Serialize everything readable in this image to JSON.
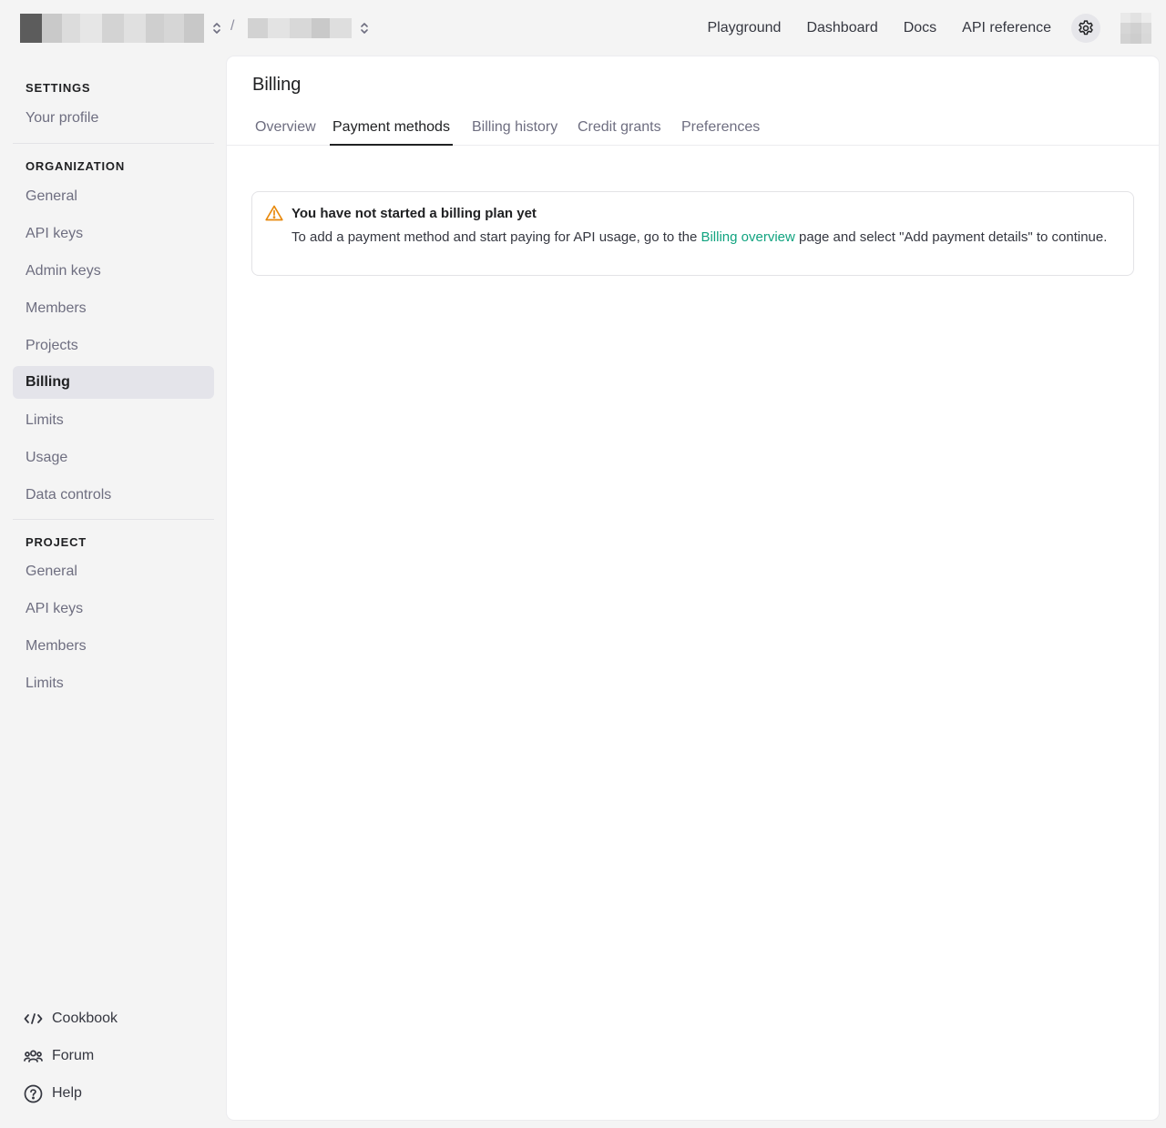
{
  "header": {
    "org_switcher": {
      "icon": "chevron-up-down-icon"
    },
    "separator": "/",
    "project_switcher": {
      "icon": "chevron-up-down-icon"
    },
    "nav": [
      "Playground",
      "Dashboard",
      "Docs",
      "API reference"
    ],
    "settings_icon": "gear-icon"
  },
  "sidebar": {
    "settings_label": "SETTINGS",
    "settings_items": [
      "Your profile"
    ],
    "organization_label": "ORGANIZATION",
    "organization_items": [
      "General",
      "API keys",
      "Admin keys",
      "Members",
      "Projects",
      "Billing",
      "Limits",
      "Usage",
      "Data controls"
    ],
    "active_item": "Billing",
    "project_label": "PROJECT",
    "project_items": [
      "General",
      "API keys",
      "Members",
      "Limits"
    ],
    "bottom_links": [
      {
        "label": "Cookbook",
        "icon": "code-icon"
      },
      {
        "label": "Forum",
        "icon": "people-icon"
      },
      {
        "label": "Help",
        "icon": "help-circle-icon"
      }
    ]
  },
  "main": {
    "title": "Billing",
    "tabs": [
      "Overview",
      "Payment methods",
      "Billing history",
      "Credit grants",
      "Preferences"
    ],
    "active_tab": "Payment methods",
    "notice": {
      "icon": "warning-icon",
      "title": "You have not started a billing plan yet",
      "body_before": "To add a payment method and start paying for API usage, go to the",
      "link_text": "Billing overview",
      "body_after": "page and select \"Add payment details\" to continue."
    }
  },
  "colors": {
    "page_bg": "#f4f4f4",
    "panel_bg": "#ffffff",
    "active_item_bg": "#e4e4ea",
    "link": "#10a37f",
    "warning": "#e8890c"
  }
}
